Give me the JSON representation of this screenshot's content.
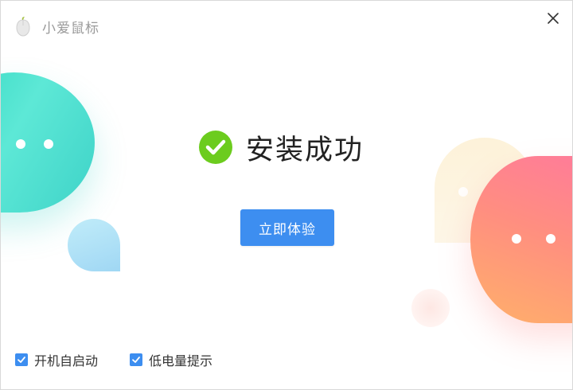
{
  "window": {
    "title": "小爱鼠标",
    "icons": {
      "app": "mouse-logo-icon",
      "close": "close-icon"
    }
  },
  "main": {
    "status_text": "安装成功",
    "status_icon": "check-circle-icon",
    "primary_button": "立即体验"
  },
  "options": [
    {
      "label": "开机自启动",
      "checked": true
    },
    {
      "label": "低电量提示",
      "checked": true
    }
  ],
  "colors": {
    "accent": "#3d8ef0",
    "success": "#6ccc1e",
    "teal_blob": "#35d9c2",
    "pink_blob": "#ff7a9b",
    "orange_blob": "#ffb06a",
    "cream_blob": "#fdf2d8"
  }
}
